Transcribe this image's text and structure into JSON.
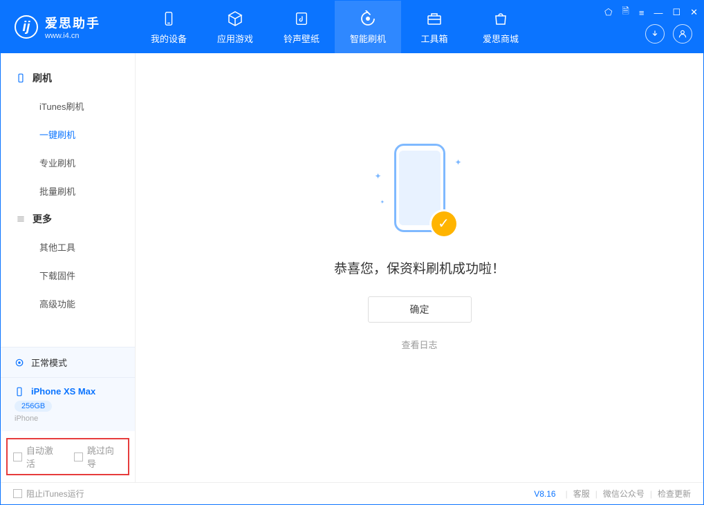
{
  "app": {
    "title": "爱思助手",
    "url": "www.i4.cn"
  },
  "nav": [
    {
      "label": "我的设备",
      "icon": "device"
    },
    {
      "label": "应用游戏",
      "icon": "cube"
    },
    {
      "label": "铃声壁纸",
      "icon": "music"
    },
    {
      "label": "智能刷机",
      "icon": "refresh",
      "active": true
    },
    {
      "label": "工具箱",
      "icon": "toolbox"
    },
    {
      "label": "爱思商城",
      "icon": "store"
    }
  ],
  "sidebar": {
    "group1": {
      "title": "刷机",
      "items": [
        "iTunes刷机",
        "一键刷机",
        "专业刷机",
        "批量刷机"
      ],
      "active_index": 1
    },
    "group2": {
      "title": "更多",
      "items": [
        "其他工具",
        "下载固件",
        "高级功能"
      ]
    }
  },
  "device": {
    "mode": "正常模式",
    "name": "iPhone XS Max",
    "capacity": "256GB",
    "type": "iPhone"
  },
  "options": {
    "auto_activate": "自动激活",
    "skip_guide": "跳过向导"
  },
  "main": {
    "success_msg": "恭喜您，保资料刷机成功啦！",
    "ok": "确定",
    "view_log": "查看日志"
  },
  "footer": {
    "block_itunes": "阻止iTunes运行",
    "version": "V8.16",
    "support": "客服",
    "wechat": "微信公众号",
    "update": "检查更新"
  }
}
